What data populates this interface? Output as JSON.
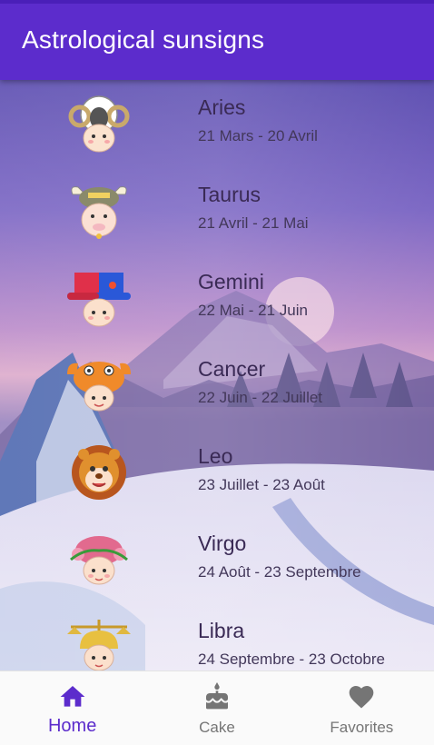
{
  "app": {
    "title": "Astrological sunsigns",
    "accent_color": "#5c2ccc"
  },
  "signs": [
    {
      "name": "Aries",
      "dates": "21 Mars - 20 Avril",
      "icon": "aries-ram-icon"
    },
    {
      "name": "Taurus",
      "dates": "21 Avril - 21 Mai",
      "icon": "taurus-bull-icon"
    },
    {
      "name": "Gemini",
      "dates": "22 Mai - 21 Juin",
      "icon": "gemini-hat-icon"
    },
    {
      "name": "Cancer",
      "dates": "22 Juin - 22 Juillet",
      "icon": "cancer-crab-icon"
    },
    {
      "name": "Leo",
      "dates": "23 Juillet - 23 Août",
      "icon": "leo-lion-icon"
    },
    {
      "name": "Virgo",
      "dates": "24 Août - 23 Septembre",
      "icon": "virgo-flowers-icon"
    },
    {
      "name": "Libra",
      "dates": "24 Septembre - 23 Octobre",
      "icon": "libra-scales-icon"
    }
  ],
  "bottom_nav": {
    "items": [
      {
        "label": "Home",
        "icon": "home-icon",
        "active": true
      },
      {
        "label": "Cake",
        "icon": "cake-icon",
        "active": false
      },
      {
        "label": "Favorites",
        "icon": "heart-icon",
        "active": false
      }
    ]
  }
}
